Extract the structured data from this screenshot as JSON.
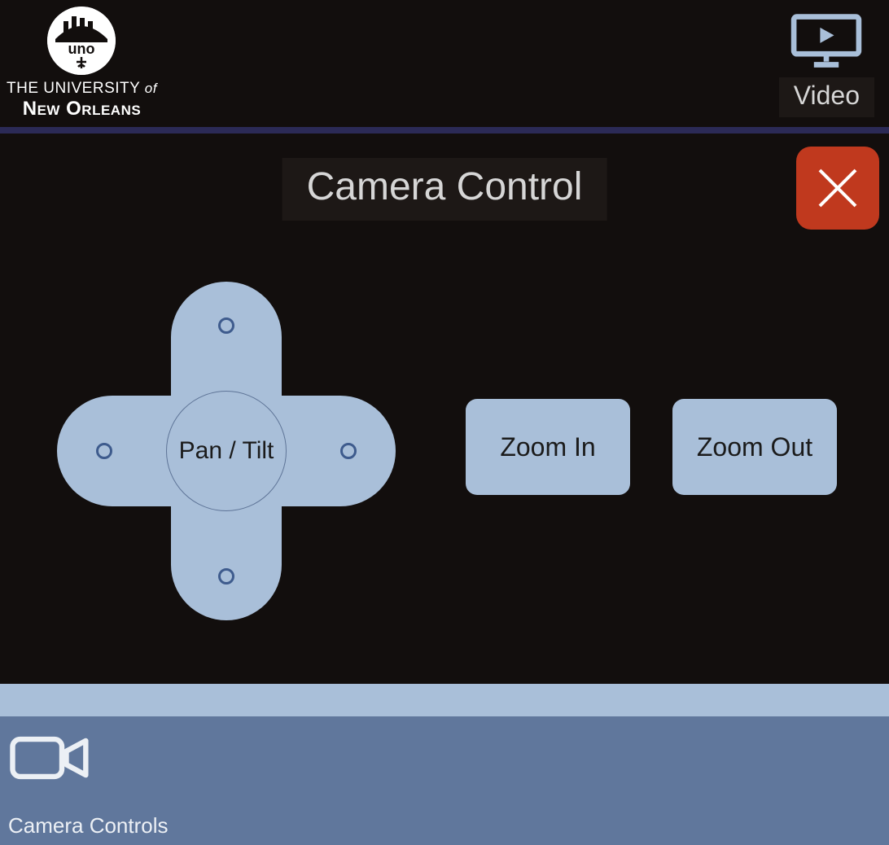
{
  "header": {
    "logo": {
      "line1_prefix": "THE UNIVERSITY",
      "line1_suffix": "of",
      "line2": "New Orleans",
      "short": "uno"
    },
    "video_label": "Video"
  },
  "main": {
    "title": "Camera Control",
    "dpad_center_label": "Pan / Tilt",
    "zoom_in_label": "Zoom In",
    "zoom_out_label": "Zoom Out"
  },
  "footer": {
    "label": "Camera Controls"
  },
  "colors": {
    "accent_blue": "#a9bfd9",
    "close_red": "#c0391e",
    "footer_blue": "#60779c"
  }
}
